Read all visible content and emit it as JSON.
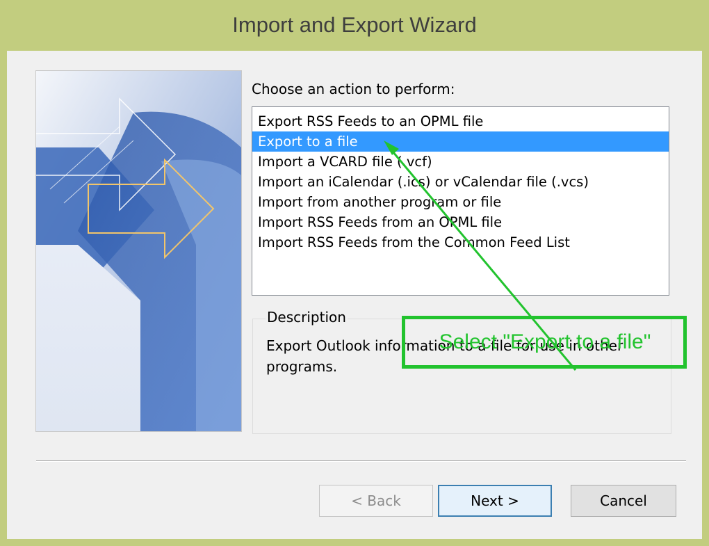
{
  "window": {
    "title": "Import and Export Wizard"
  },
  "wizard": {
    "prompt": "Choose an action to perform:",
    "actions": [
      "Export RSS Feeds to an OPML file",
      "Export to a file",
      "Import a VCARD file (.vcf)",
      "Import an iCalendar (.ics) or vCalendar file (.vcs)",
      "Import from another program or file",
      "Import RSS Feeds from an OPML file",
      "Import RSS Feeds from the Common Feed List"
    ],
    "selected_action": "Export to a file",
    "description": {
      "legend": "Description",
      "text": "Export Outlook information to a file for use in other programs."
    }
  },
  "buttons": {
    "back": "< Back",
    "next": "Next >",
    "cancel": "Cancel"
  },
  "annotation": {
    "text": "Select \"Export to a file\"",
    "color": "#22c32e"
  },
  "colors": {
    "selection": "#3399ff",
    "frame": "#c2cd7f"
  }
}
